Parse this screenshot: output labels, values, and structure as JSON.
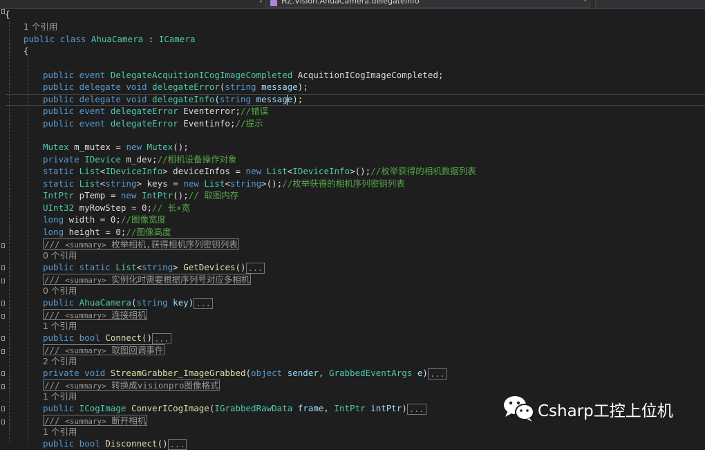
{
  "nav": {
    "member": "HZ.Vision.AhuaCamera.delegateInfo"
  },
  "editor": {
    "open_brace": "{",
    "refs": {
      "r1": "1 个引用",
      "r0a": "0 个引用",
      "r0b": "0 个引用",
      "r1b": "1 个引用",
      "r2": "2 个引用",
      "r1c": "1 个引用",
      "r1d": "1 个引用"
    },
    "class_decl": {
      "kw1": "public",
      "kw2": "class",
      "name": "AhuaCamera",
      "sep": " : ",
      "base": "ICamera"
    },
    "class_brace": "{",
    "members": {
      "l1": {
        "kw": "public event",
        "type": "DelegateAcquitionICogImageCompleted",
        "rest": " AcquitionICogImageCompleted;"
      },
      "l2": {
        "kw": "public delegate void",
        "name": "delegateError",
        "p1": "(",
        "ptype": "string",
        "pname": " message",
        "end": ");"
      },
      "l3": {
        "kw": "public delegate void",
        "name": "delegateInfo",
        "p1": "(",
        "ptype": "string",
        "pname": " message",
        "end": ");"
      },
      "l4": {
        "kw": "public event",
        "type": "delegateError",
        "rest": " Eventerror;",
        "comment": "//错误"
      },
      "l5": {
        "kw": "public event",
        "type": "delegateError",
        "rest": " Eventinfo;",
        "comment": "//提示"
      },
      "l6": {
        "type": "Mutex",
        "rest1": " m_mutex = ",
        "kw": "new",
        "type2": " Mutex",
        "rest2": "();"
      },
      "l7": {
        "kw": "private",
        "type": " IDevice",
        "rest": " m_dev;",
        "comment": "//相机设备操作对象"
      },
      "l8": {
        "kw": "static",
        "type": " List",
        "a1": "<",
        "type2": "IDeviceInfo",
        "a2": "> deviceInfos = ",
        "kw2": "new",
        "type3": " List",
        "a3": "<",
        "type4": "IDeviceInfo",
        "a4": ">();",
        "comment": "//枚举获得的相机数据列表"
      },
      "l9": {
        "kw": "static",
        "type": " List",
        "a1": "<",
        "kw2": "string",
        "a2": "> keys = ",
        "kw3": "new",
        "type3": " List",
        "a3": "<",
        "kw4": "string",
        "a4": ">();",
        "comment": "//枚举获得的相机序列密钥列表"
      },
      "l10": {
        "type": "IntPtr",
        "rest1": " pTemp = ",
        "kw": "new",
        "type2": " IntPtr",
        "rest2": "();",
        "comment": "// 取图内存"
      },
      "l11": {
        "type": "UInt32",
        "rest": " myRowStep = 0;",
        "comment": "// 长×宽"
      },
      "l12": {
        "kw": "long",
        "rest": " width = 0;",
        "comment": "//图像宽度"
      },
      "l13": {
        "kw": "long",
        "rest": " height = 0;",
        "comment": "//图像高度"
      }
    },
    "summaries": {
      "s1": {
        "prefix": "/// ",
        "tag": "<summary>",
        "text": " 枚举相机,获得相机序列密钥列表"
      },
      "s2": {
        "prefix": "/// ",
        "tag": "<summary>",
        "text": " 实例化时需要根据序列号对应多相机"
      },
      "s3": {
        "prefix": "/// ",
        "tag": "<summary>",
        "text": " 连接相机"
      },
      "s4": {
        "prefix": "/// ",
        "tag": "<summary>",
        "text": " 取图回调事件"
      },
      "s5": {
        "prefix": "/// ",
        "tag": "<summary>",
        "text": " 转换成visionpro图像格式"
      },
      "s6": {
        "prefix": "/// ",
        "tag": "<summary>",
        "text": " 断开相机"
      }
    },
    "methods": {
      "m1": {
        "kw": "public static",
        "type": " List",
        "a1": "<",
        "kw2": "string",
        "a2": "> ",
        "name": "GetDevices",
        "p": "()",
        "collapsed": "..."
      },
      "m2": {
        "kw": "public",
        "name": " AhuaCamera",
        "p1": "(",
        "ptype": "string",
        "pname": " key",
        "p2": ")",
        "collapsed": "..."
      },
      "m3": {
        "kw": "public bool",
        "name": " Connect",
        "p": "()",
        "collapsed": "..."
      },
      "m4": {
        "kw": "private void",
        "name": " StreamGrabber_ImageGrabbed",
        "p1": "(",
        "ptype": "object",
        "pname": " sender, ",
        "ptype2": "GrabbedEventArgs",
        "pname2": " e",
        "p2": ")",
        "collapsed": "..."
      },
      "m5": {
        "kw": "public",
        "type": " ICogImage",
        "name": " ConverICogImage",
        "p1": "(",
        "ptype": "IGrabbedRawData",
        "pname": " frame, ",
        "ptype2": "IntPtr",
        "pname2": " intPtr",
        "p2": ")",
        "collapsed": "..."
      },
      "m6": {
        "kw": "public bool",
        "name": " Disconnect",
        "p": "()",
        "collapsed": "..."
      }
    }
  },
  "watermark": {
    "text": "Csharp工控上位机"
  }
}
